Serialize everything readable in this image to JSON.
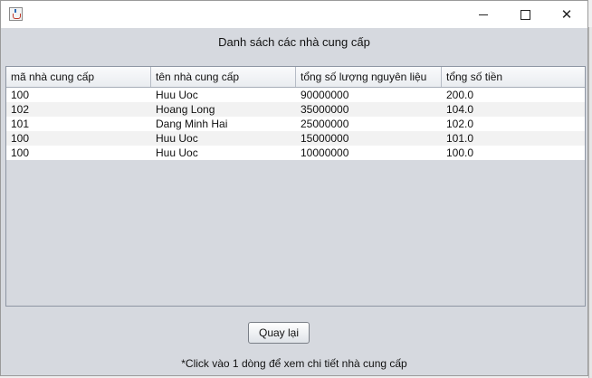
{
  "window": {
    "title": "",
    "icon": "java-cup-icon",
    "controls": [
      "minimize",
      "maximize",
      "close"
    ],
    "close_glyph": "✕"
  },
  "heading": "Danh sách các nhà cung cấp",
  "table": {
    "columns": [
      "mã nhà cung cấp",
      "tên nhà cung cấp",
      "tổng số lượng nguyên liệu",
      "tổng số tiền"
    ],
    "rows": [
      [
        "100",
        "Huu Uoc",
        "90000000",
        "200.0"
      ],
      [
        "102",
        "Hoang Long",
        "35000000",
        "104.0"
      ],
      [
        "101",
        "Dang Minh Hai",
        "25000000",
        "102.0"
      ],
      [
        "100",
        "Huu Uoc",
        "15000000",
        "101.0"
      ],
      [
        "100",
        "Huu Uoc",
        "10000000",
        "100.0"
      ]
    ]
  },
  "back_button": "Quay lại",
  "hint": "*Click vào 1 dòng để xem chi tiết nhà cung cấp"
}
